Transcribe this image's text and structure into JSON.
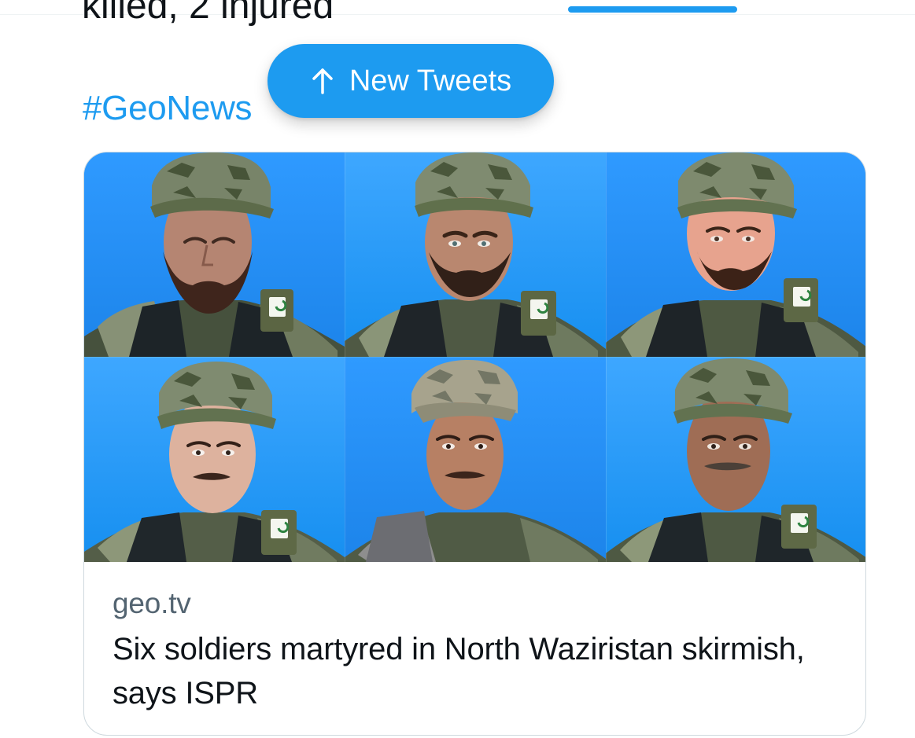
{
  "tweet": {
    "clipped_text": "killed, 2 injured",
    "hashtag": "#GeoNews"
  },
  "new_tweets": {
    "label": "New Tweets",
    "icon": "arrow-up-icon"
  },
  "link_card": {
    "domain": "geo.tv",
    "headline": "Six soldiers martyred in North Waziristan skirmish, says ISPR",
    "portrait_count": 6
  },
  "colors": {
    "accent": "#1d9bf0",
    "text": "#0f1419",
    "muted": "#536471",
    "card_border": "#cfd9de",
    "photo_background": "#1e8ef0"
  }
}
